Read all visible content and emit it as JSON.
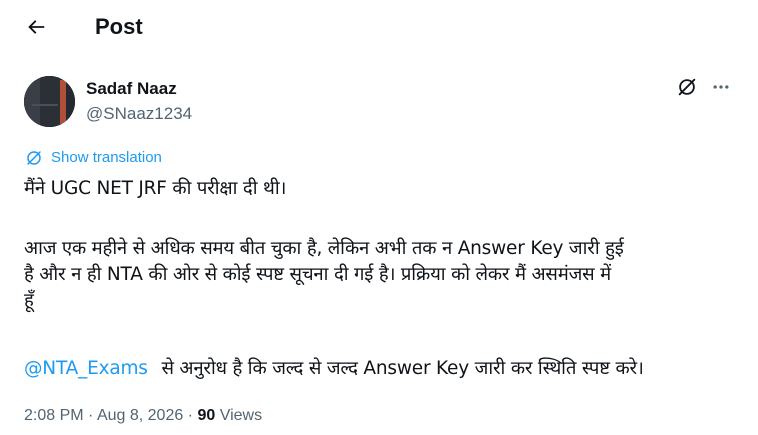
{
  "header": {
    "title": "Post"
  },
  "author": {
    "display_name": "Sadaf Naaz",
    "handle": "@SNaaz1234"
  },
  "translation": {
    "label": "Show translation"
  },
  "tweet": {
    "line1": "मैंने UGC NET JRF की परीक्षा दी थी।",
    "line2a": "आज एक महीने से अधिक समय बीत चुका है, लेकिन अभी तक न Answer Key जारी हुई",
    "line2b": "है और न ही NTA की ओर से कोई स्पष्ट सूचना दी गई है। प्रक्रिया को लेकर मैं असमंजस में",
    "line2c": "हूँ",
    "mention": "@NTA_Exams",
    "line3_rest": "से अनुरोध है कि जल्द से जल्द Answer Key जारी कर स्थिति स्पष्ट करे।"
  },
  "meta": {
    "time": "2:08 PM",
    "separator1": " · ",
    "date": "Aug 8, 2026",
    "separator2": " · ",
    "views_count": "90",
    "views_label": " Views"
  },
  "icons": {
    "back": "arrow-left-icon",
    "grok": "grok-icon",
    "more": "more-horizontal-icon",
    "translate": "globe-icon"
  },
  "colors": {
    "accent": "#1d9bf0",
    "text_primary": "#0f1419",
    "text_secondary": "#536471"
  }
}
